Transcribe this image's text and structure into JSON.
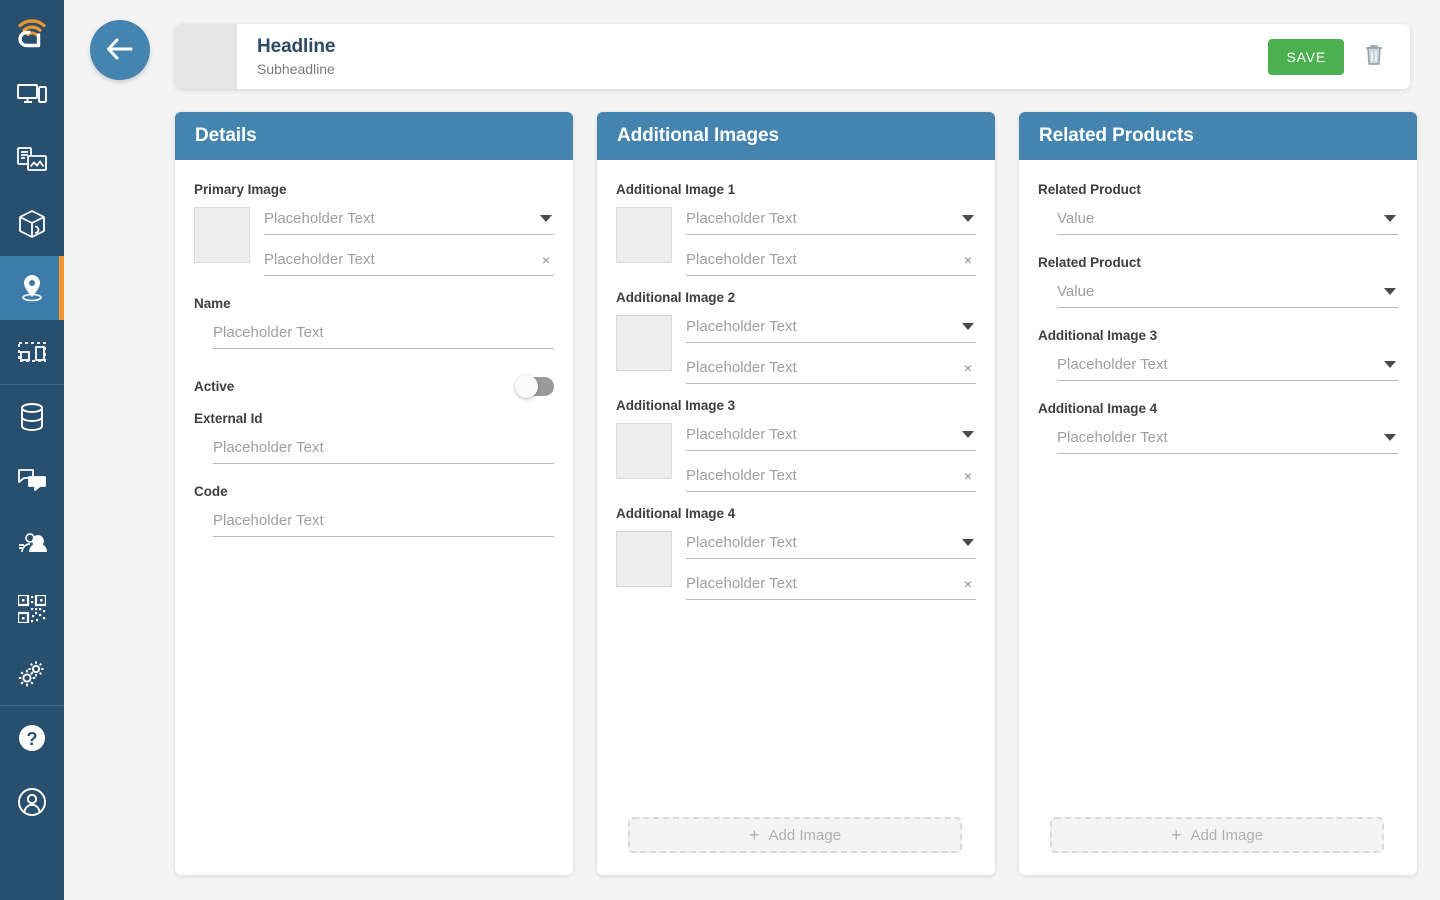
{
  "sidebar": {
    "logo": "wifi-signal-logo",
    "items": [
      {
        "icon": "devices-icon",
        "name": "sidebar-item-devices",
        "active": false
      },
      {
        "icon": "content-icon",
        "name": "sidebar-item-content",
        "active": false
      },
      {
        "icon": "package-icon",
        "name": "sidebar-item-products",
        "active": false
      },
      {
        "icon": "location-pin-icon",
        "name": "sidebar-item-locations",
        "active": true
      },
      {
        "icon": "kiosk-icon",
        "name": "sidebar-item-kiosk",
        "active": false
      },
      {
        "icon": "database-icon",
        "name": "sidebar-item-data",
        "active": false
      },
      {
        "icon": "chat-icon",
        "name": "sidebar-item-messages",
        "active": false
      },
      {
        "icon": "users-icon",
        "name": "sidebar-item-users",
        "active": false
      },
      {
        "icon": "qr-code-icon",
        "name": "sidebar-item-qr-codes",
        "active": false
      },
      {
        "icon": "gear-icon",
        "name": "sidebar-item-settings",
        "active": false
      },
      {
        "icon": "help-icon",
        "name": "sidebar-item-help",
        "active": false
      },
      {
        "icon": "account-icon",
        "name": "sidebar-item-account",
        "active": false
      }
    ],
    "colors": {
      "background": "#28506e",
      "active_background": "#3d7ba8",
      "active_accent": "#f2962c",
      "divider": "#3f6d8f"
    }
  },
  "topbar": {
    "back_icon": "arrow-left-icon",
    "title": "Headline",
    "subtitle": "Subheadline",
    "save_label": "SAVE",
    "delete_icon": "trash-icon",
    "colors": {
      "save": "#4caf50",
      "back": "#4484ae"
    }
  },
  "panels": {
    "details": {
      "title": "Details",
      "primary_image_label": "Primary Image",
      "primary_image_select_placeholder": "Placeholder Text",
      "primary_image_text_placeholder": "Placeholder Text",
      "name_label": "Name",
      "name_placeholder": "Placeholder Text",
      "active_label": "Active",
      "active_value": false,
      "external_id_label": "External Id",
      "external_id_placeholder": "Placeholder Text",
      "code_label": "Code",
      "code_placeholder": "Placeholder Text"
    },
    "additional_images": {
      "title": "Additional Images",
      "items": [
        {
          "label": "Additional Image 1",
          "select_placeholder": "Placeholder Text",
          "text_placeholder": "Placeholder Text"
        },
        {
          "label": "Additional Image 2",
          "select_placeholder": "Placeholder Text",
          "text_placeholder": "Placeholder Text"
        },
        {
          "label": "Additional Image 3",
          "select_placeholder": "Placeholder Text",
          "text_placeholder": "Placeholder Text"
        },
        {
          "label": "Additional Image 4",
          "select_placeholder": "Placeholder Text",
          "text_placeholder": "Placeholder Text"
        }
      ],
      "add_button_label": "Add Image",
      "add_button_icon": "plus-icon"
    },
    "related_products": {
      "title": "Related Products",
      "fields": [
        {
          "label": "Related Product",
          "placeholder": "Value"
        },
        {
          "label": "Related Product",
          "placeholder": "Value"
        },
        {
          "label": "Additional Image 3",
          "placeholder": "Placeholder Text"
        },
        {
          "label": "Additional Image 4",
          "placeholder": "Placeholder Text"
        }
      ],
      "add_button_label": "Add Image",
      "add_button_icon": "plus-icon"
    }
  },
  "theme": {
    "page_background": "#f4f4f4",
    "panel_header": "#4484ae",
    "panel_background": "#ffffff"
  }
}
